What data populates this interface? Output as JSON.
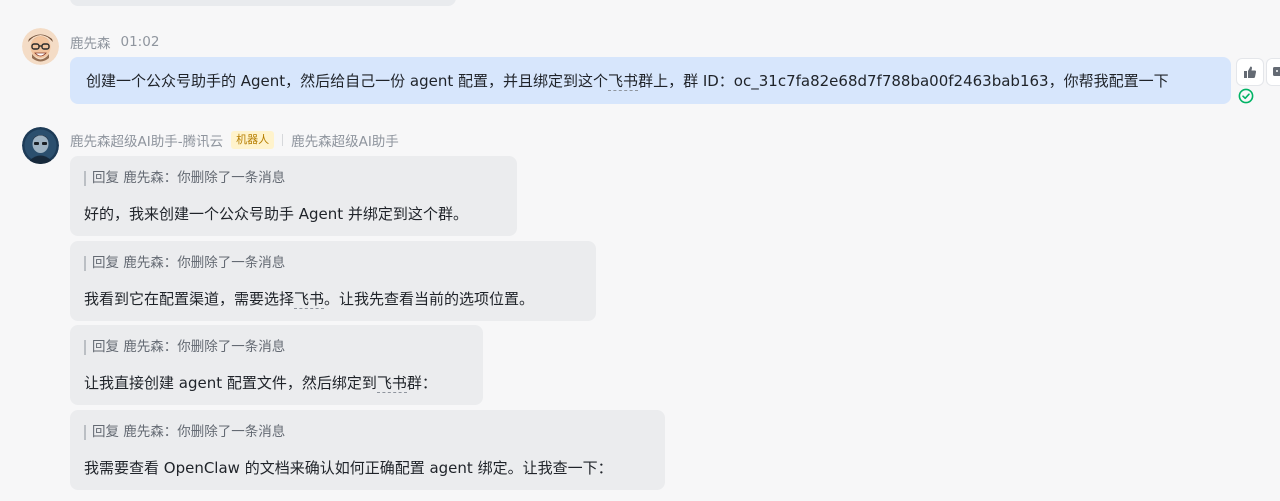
{
  "user_message": {
    "sender": "鹿先森",
    "time": "01:02",
    "text_before": "创建一个公众号助手的 Agent，然后给自己一份 agent 配置，并且绑定到这个",
    "text_link": "飞书",
    "text_after": "群上，群 ID：oc_31c7fa82e68d7f788ba00f2463bab163，你帮我配置一下"
  },
  "bot": {
    "name": "鹿先森超级AI助手-腾讯云",
    "tag": "机器人",
    "app_name": "鹿先森超级AI助手",
    "reply_prefix": "回复 鹿先森：你删除了一条消息",
    "messages": [
      {
        "before": "好的，我来创建一个公众号助手 Agent 并绑定到这个群。",
        "link": "",
        "after": ""
      },
      {
        "before": "我看到它在配置渠道，需要选择",
        "link": "飞书",
        "after": "。让我先查看当前的选项位置。"
      },
      {
        "before": "让我直接创建 agent 配置文件，然后绑定到",
        "link": "飞书",
        "after": "群："
      },
      {
        "before": "我需要查看 OpenClaw 的文档来确认如何正确配置 agent 绑定。让我查一下：",
        "link": "",
        "after": ""
      }
    ]
  },
  "icons": {
    "thumbs_up": "thumbs-up-icon",
    "emoji_add": "emoji-add-icon",
    "read_status": "check-circle-icon"
  },
  "colors": {
    "user_bubble": "#d7e6fc",
    "bot_bubble": "#ebecee",
    "bot_tag_bg": "#fff3cc",
    "read_check": "#00b365"
  }
}
